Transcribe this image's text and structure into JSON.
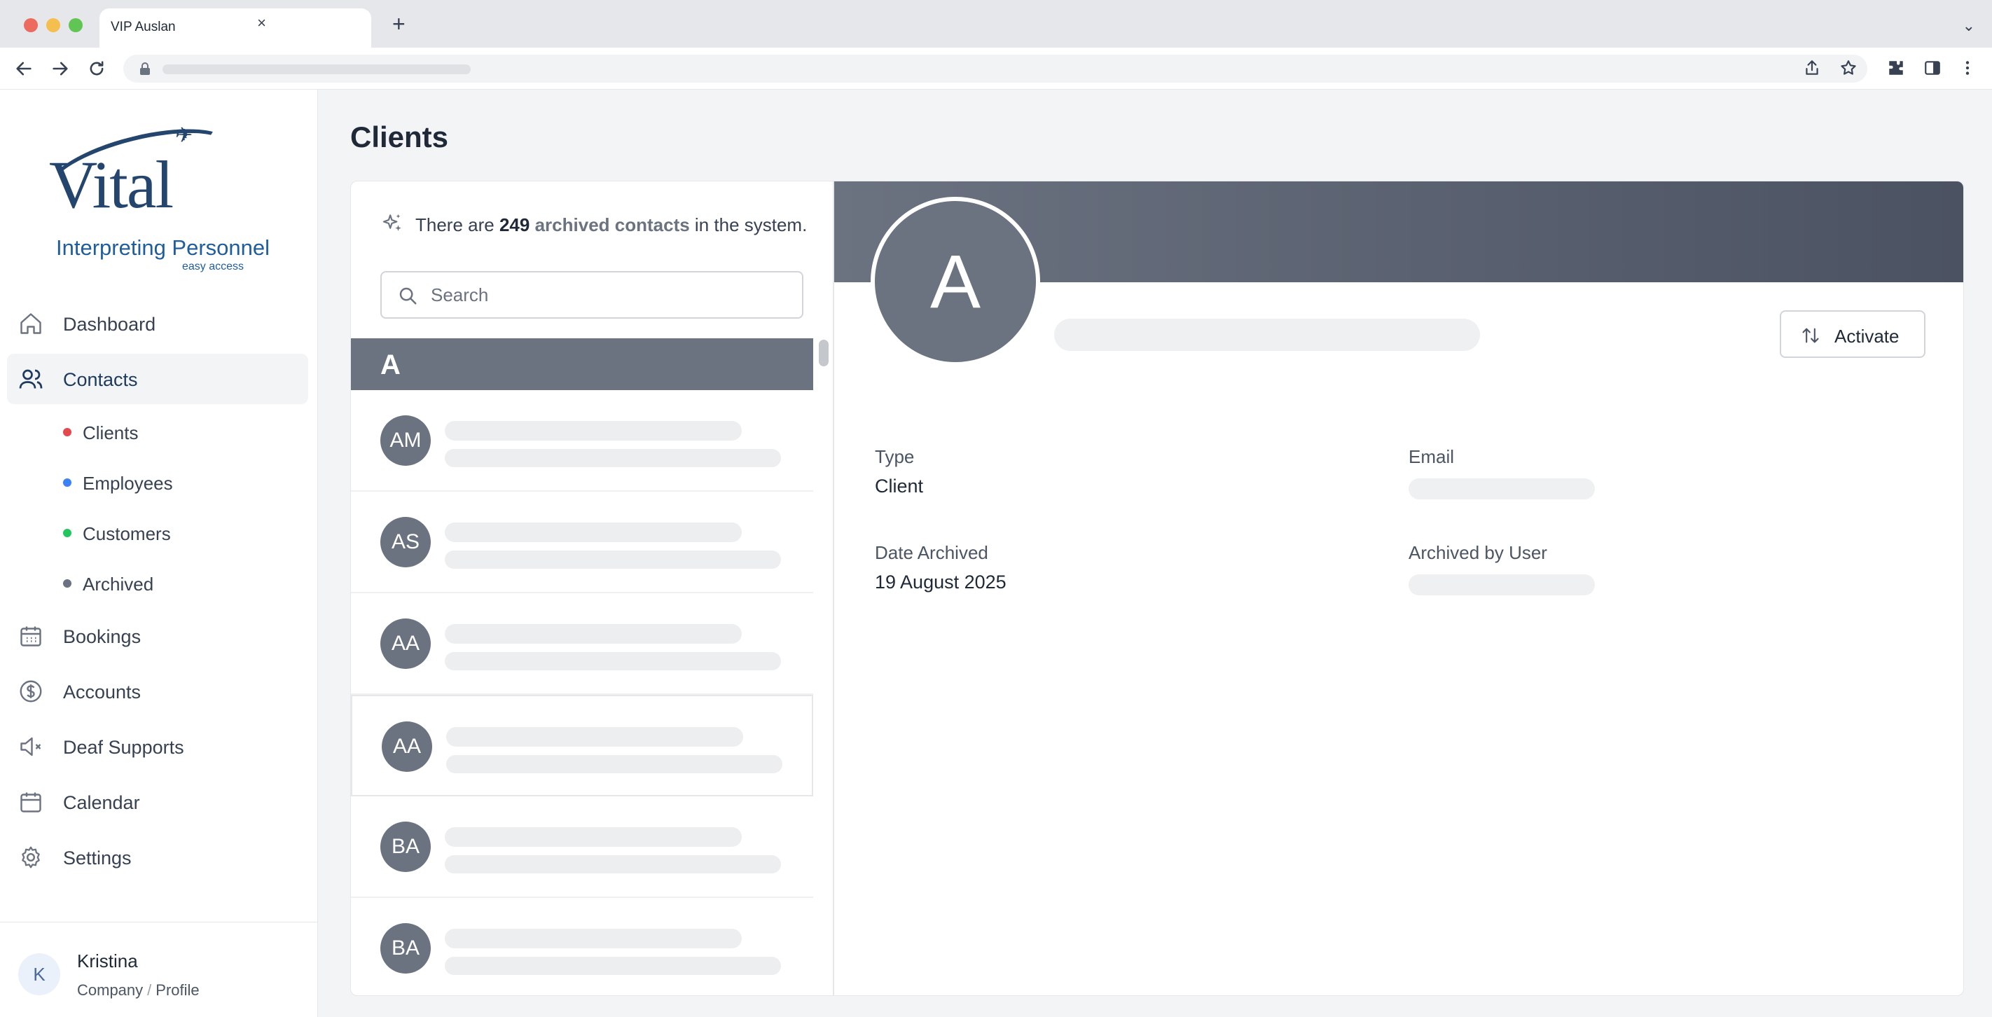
{
  "browser": {
    "tab_title": "VIP Auslan",
    "tab_close": "×",
    "new_tab": "+",
    "tab_menu": "⌄",
    "icons": [
      "back-icon",
      "forward-icon",
      "reload-icon",
      "lock-icon",
      "share-icon",
      "bookmark-icon",
      "extensions-icon",
      "sidebar-icon",
      "menu-icon"
    ]
  },
  "logo": {
    "brand": "Vital",
    "subtitle": "Interpreting Personnel",
    "tagline": "easy access"
  },
  "sidebar": {
    "items": [
      {
        "label": "Dashboard",
        "icon": "home-icon"
      },
      {
        "label": "Contacts",
        "icon": "users-icon",
        "active": true
      },
      {
        "label": "Bookings",
        "icon": "calendar-grid-icon"
      },
      {
        "label": "Accounts",
        "icon": "dollar-icon"
      },
      {
        "label": "Deaf Supports",
        "icon": "mute-icon"
      },
      {
        "label": "Calendar",
        "icon": "calendar-icon"
      },
      {
        "label": "Settings",
        "icon": "gear-icon"
      }
    ],
    "subitems": [
      {
        "label": "Clients",
        "color": "#e5484d"
      },
      {
        "label": "Employees",
        "color": "#3b82f6"
      },
      {
        "label": "Customers",
        "color": "#22c55e"
      },
      {
        "label": "Archived",
        "color": "#6b7280"
      }
    ]
  },
  "user": {
    "initial": "K",
    "name": "Kristina",
    "company_link": "Company",
    "separator": "/",
    "profile_link": "Profile"
  },
  "page": {
    "title": "Clients"
  },
  "list": {
    "summary_prefix": "There are",
    "count": "249",
    "summary_highlight": "archived contacts",
    "summary_suffix": "in the system.",
    "search_placeholder": "Search",
    "section_letter": "A",
    "rows": [
      {
        "initials": "AM"
      },
      {
        "initials": "AS"
      },
      {
        "initials": "AA"
      },
      {
        "initials": "AA",
        "selected": true
      },
      {
        "initials": "BA"
      },
      {
        "initials": "BA"
      }
    ]
  },
  "detail": {
    "avatar_letter": "A",
    "activate_label": "Activate",
    "type_label": "Type",
    "type_value": "Client",
    "email_label": "Email",
    "date_archived_label": "Date Archived",
    "date_archived_value": "19 August 2025",
    "archived_by_label": "Archived by User"
  }
}
